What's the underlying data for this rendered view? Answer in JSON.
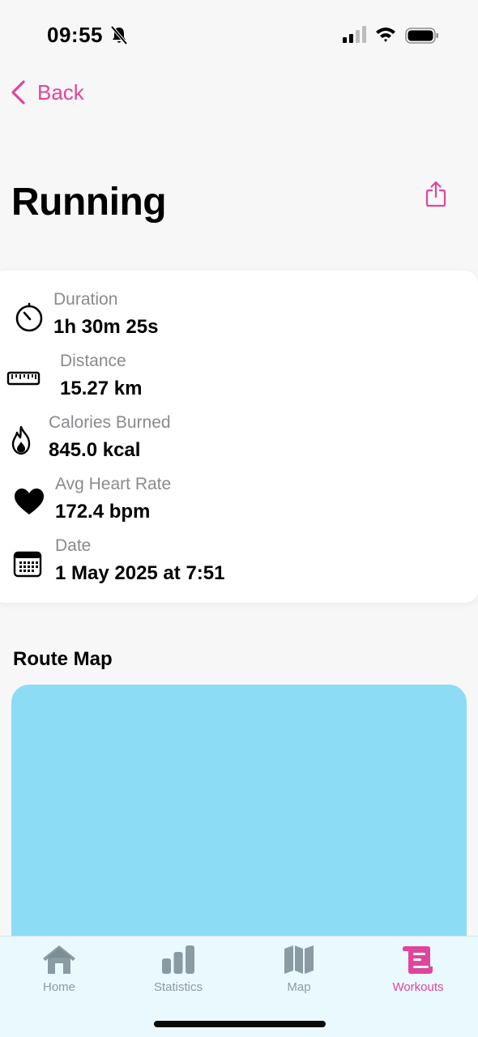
{
  "status_bar": {
    "time": "09:55"
  },
  "nav": {
    "back_label": "Back"
  },
  "page": {
    "title": "Running"
  },
  "stats": [
    {
      "icon": "stopwatch-icon",
      "label": "Duration",
      "value": "1h 30m 25s"
    },
    {
      "icon": "ruler-icon",
      "label": "Distance",
      "value": "15.27 km"
    },
    {
      "icon": "flame-icon",
      "label": "Calories Burned",
      "value": "845.0 kcal"
    },
    {
      "icon": "heart-icon",
      "label": "Avg Heart Rate",
      "value": "172.4 bpm"
    },
    {
      "icon": "calendar-icon",
      "label": "Date",
      "value": "1 May 2025 at 7:51"
    }
  ],
  "route": {
    "title": "Route Map"
  },
  "tabs": [
    {
      "icon": "house-icon",
      "label": "Home",
      "active": false
    },
    {
      "icon": "bar-chart-icon",
      "label": "Statistics",
      "active": false
    },
    {
      "icon": "map-icon",
      "label": "Map",
      "active": false
    },
    {
      "icon": "scroll-icon",
      "label": "Workouts",
      "active": true
    }
  ],
  "colors": {
    "accent": "#e0459c",
    "map_fill": "#8ddcf6",
    "tab_bar_bg": "#eaf9fd",
    "tab_inactive": "#8a9ba3",
    "secondary_text": "#8a8a8e"
  }
}
